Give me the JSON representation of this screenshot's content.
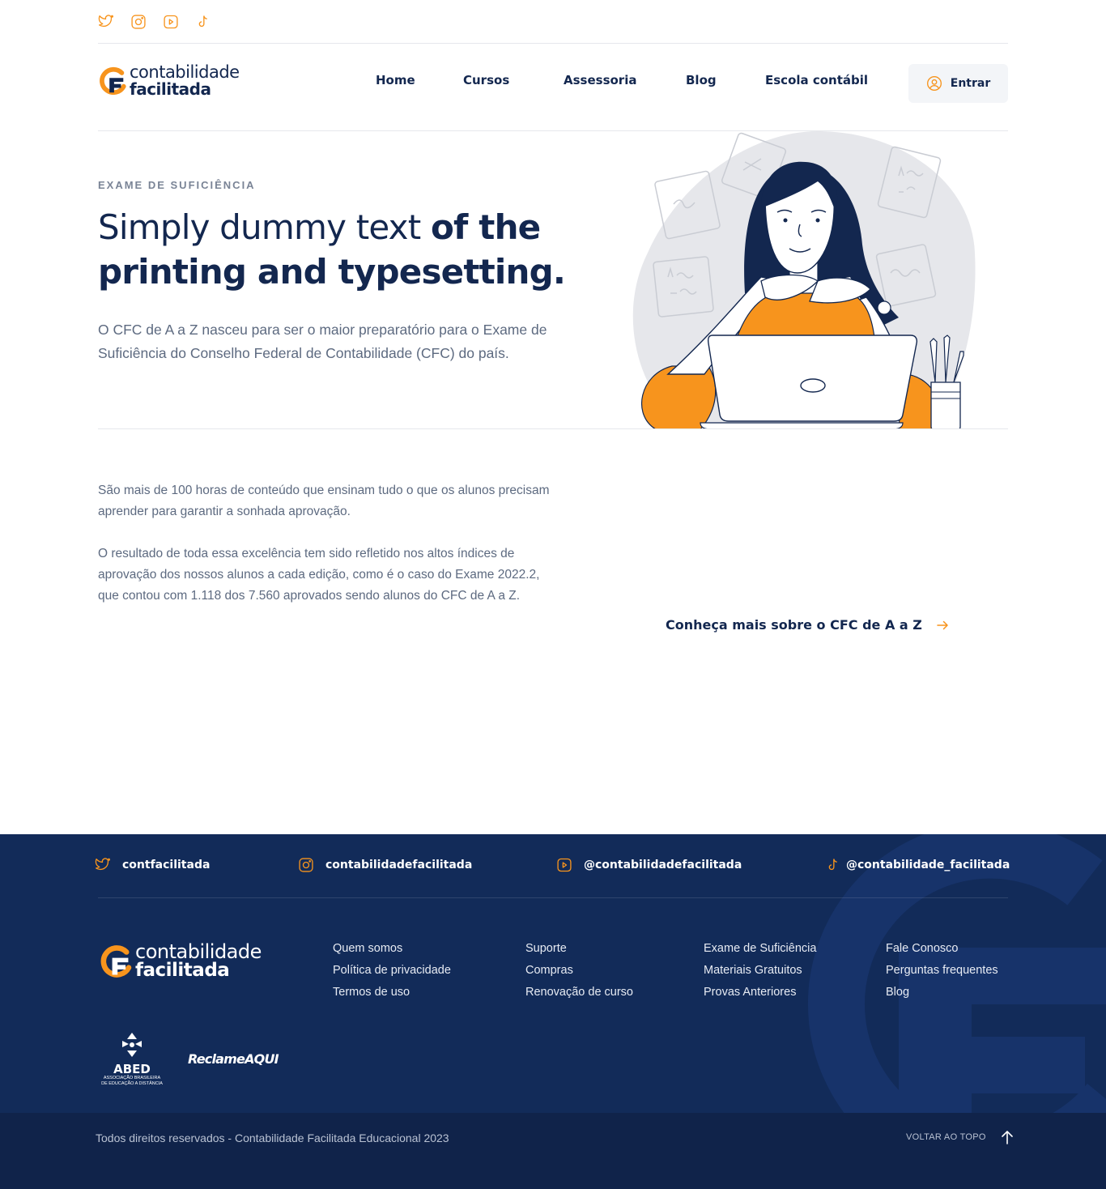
{
  "colors": {
    "brand_orange": "#f7941d",
    "navy": "#13274f",
    "footer_bg": "#122b59",
    "footer_bottom_bg": "#10234a",
    "muted_text": "#5d6a80"
  },
  "top_social": [
    {
      "icon": "twitter-icon"
    },
    {
      "icon": "instagram-icon"
    },
    {
      "icon": "youtube-icon"
    },
    {
      "icon": "tiktok-icon"
    }
  ],
  "header": {
    "logo_line1": "contabilidade",
    "logo_line2": "facilitada",
    "nav": [
      "Home",
      "Cursos",
      "Assessoria",
      "Blog",
      "Escola contábil"
    ],
    "login_label": "Entrar",
    "login_icon": "user-circle-icon"
  },
  "hero": {
    "eyebrow": "EXAME DE SUFICIÊNCIA",
    "headline_light": "Simply dummy text ",
    "headline_bold_1": "of the",
    "headline_bold_2": "printing and typesetting.",
    "text": "O CFC de A a Z nasceu para ser o maior preparatório para o Exame de Suficiência do Conselho Federal de Contabilidade (CFC) do país."
  },
  "content": {
    "paragraph_1": " São mais de 100 horas de conteúdo que ensinam tudo o que os alunos precisam aprender para garantir a sonhada aprovação.",
    "paragraph_2": "O resultado de toda essa excelência tem sido refletido nos altos índices de aprovação dos nossos alunos a cada edição, como é o caso do Exame 2022.2, que contou com 1.118 dos 7.560 aprovados sendo alunos do CFC de A a Z.",
    "cta_label": "Conheça mais sobre o CFC de A a Z",
    "cta_icon": "arrow-right-icon"
  },
  "footer": {
    "social": [
      {
        "icon": "twitter-icon",
        "handle": "contfacilitada"
      },
      {
        "icon": "instagram-icon",
        "handle": "contabilidadefacilitada"
      },
      {
        "icon": "youtube-icon",
        "handle": "@contabilidadefacilitada"
      },
      {
        "icon": "tiktok-icon",
        "handle": "@contabilidade_facilitada"
      }
    ],
    "logo_line1": "contabilidade",
    "logo_line2": "facilitada",
    "columns": [
      [
        "Quem somos",
        "Política de privacidade",
        "Termos de uso"
      ],
      [
        "Suporte",
        "Compras",
        "Renovação de curso"
      ],
      [
        "Exame de Suficiência",
        "Materiais Gratuitos",
        "Provas Anteriores"
      ],
      [
        "Fale Conosco",
        "Perguntas frequentes",
        "Blog"
      ]
    ],
    "abed_name": "ABED",
    "abed_sub_1": "ASSOCIAÇÃO BRASILEIRA",
    "abed_sub_2": "DE EDUCAÇÃO A DISTÂNCIA",
    "reclame_aqui": "ReclameAQUI",
    "copyright": "Todos direitos reservados - Contabilidade Facilitada Educacional 2023",
    "back_to_top": "VOLTAR AO TOPO",
    "back_to_top_icon": "arrow-up-icon"
  }
}
